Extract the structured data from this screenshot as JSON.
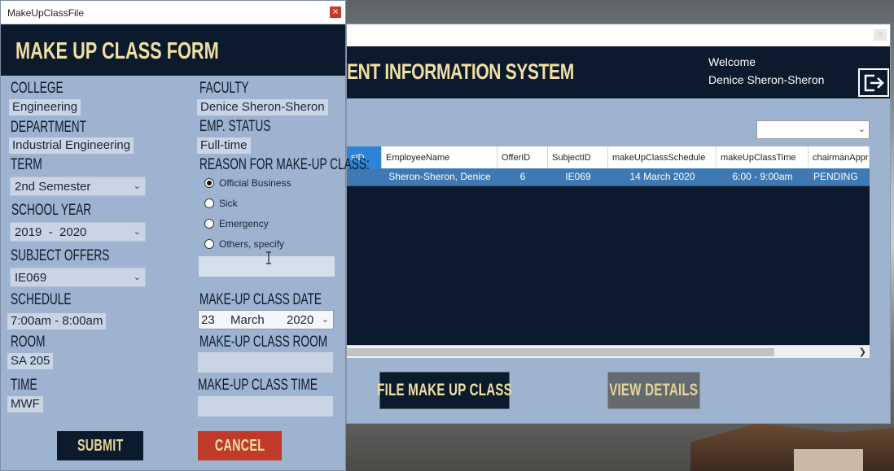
{
  "main_window": {
    "title": "ENT INFORMATION SYSTEM",
    "welcome_label": "Welcome",
    "welcome_name": "Denice Sheron-Sheron",
    "close_glyph": "×",
    "filter_value": "",
    "grid": {
      "columns": [
        "sID",
        "EmployeeName",
        "OfferID",
        "SubjectID",
        "makeUpClassSchedule",
        "makeUpClassTime",
        "chairmanApprov"
      ],
      "rows": [
        {
          "id": "",
          "employee": "Sheron-Sheron, Denice",
          "offer": "6",
          "subject": "IE069",
          "schedule": "14 March 2020",
          "time": "6:00 - 9:00am",
          "approval": "PENDING"
        }
      ]
    },
    "buttons": {
      "file": "FILE MAKE UP CLASS",
      "view": "VIEW DETAILS"
    },
    "icons": {
      "logout": "logout-icon",
      "chevron": "chevron-down-icon",
      "scroll_right": "chevron-right-icon"
    }
  },
  "dialog": {
    "window_title": "MakeUpClassFile",
    "close_glyph": "×",
    "heading": "MAKE UP CLASS FORM",
    "college": {
      "label": "COLLEGE",
      "value": "Engineering"
    },
    "department": {
      "label": "DEPARTMENT",
      "value": "Industrial Engineering"
    },
    "term": {
      "label": "TERM",
      "value": "2nd Semester"
    },
    "school_year": {
      "label": "SCHOOL YEAR",
      "value": "2019  -  2020"
    },
    "subject_offers": {
      "label": "SUBJECT OFFERS",
      "value": "IE069"
    },
    "schedule": {
      "label": "SCHEDULE",
      "value": "7:00am - 8:00am"
    },
    "room": {
      "label": "ROOM",
      "value": "SA 205"
    },
    "time": {
      "label": "TIME",
      "value": "MWF"
    },
    "faculty": {
      "label": "FACULTY",
      "value": "Denice Sheron-Sheron"
    },
    "emp_status": {
      "label": "EMP. STATUS",
      "value": "Full-time"
    },
    "reason": {
      "label": "REASON FOR MAKE-UP CLASS:",
      "options": [
        "Official Business",
        "Sick",
        "Emergency",
        "Others, specify"
      ],
      "selected": "Official Business",
      "others_value": ""
    },
    "makeup_date": {
      "label": "MAKE-UP CLASS DATE",
      "day": "23",
      "month": "March",
      "year": "2020"
    },
    "makeup_room": {
      "label": "MAKE-UP CLASS ROOM",
      "value": ""
    },
    "makeup_time": {
      "label": "MAKE-UP CLASS TIME",
      "value": ""
    },
    "buttons": {
      "submit": "SUBMIT",
      "cancel": "CANCEL"
    }
  }
}
